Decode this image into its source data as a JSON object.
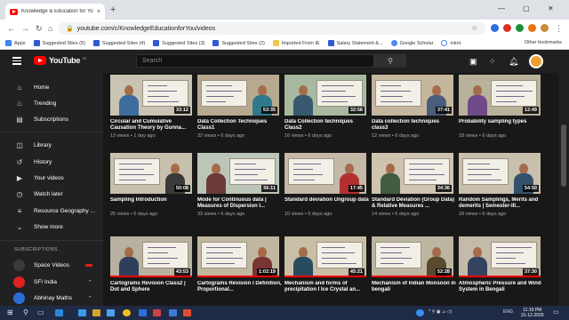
{
  "browser": {
    "tab_title": "Knowledge & Education for You",
    "tab_close": "×",
    "new_tab": "+",
    "url": "youtube.com/c/KnowledgeEducationforYou/videos",
    "window_controls": [
      "—",
      "▢",
      "✕"
    ],
    "bookmarks": [
      {
        "label": "Apps",
        "icon": "apps-grid-icon"
      },
      {
        "label": "Suggested Sites (5)",
        "icon": "bookmark-icon"
      },
      {
        "label": "Suggested Sites (4)",
        "icon": "bookmark-icon"
      },
      {
        "label": "Suggested Sites (3)",
        "icon": "bookmark-icon"
      },
      {
        "label": "Suggested Sites (2)",
        "icon": "bookmark-icon"
      },
      {
        "label": "Imported From IE",
        "icon": "folder-icon"
      },
      {
        "label": "Salary Statement &...",
        "icon": "bookmark-icon"
      },
      {
        "label": "Google Scholar",
        "icon": "scholar-icon"
      },
      {
        "label": "inknt",
        "icon": "google-icon"
      }
    ],
    "other_bookmarks": "Other bookmarks"
  },
  "youtube": {
    "logo_text": "YouTube",
    "logo_region": "IN",
    "search_placeholder": "Search"
  },
  "sidebar": {
    "primary": [
      {
        "label": "Home",
        "icon": "home-icon"
      },
      {
        "label": "Trending",
        "icon": "flame-icon"
      },
      {
        "label": "Subscriptions",
        "icon": "subscriptions-icon"
      }
    ],
    "library": [
      {
        "label": "Library",
        "icon": "library-icon"
      },
      {
        "label": "History",
        "icon": "history-icon"
      },
      {
        "label": "Your videos",
        "icon": "your-videos-icon"
      },
      {
        "label": "Watch later",
        "icon": "clock-icon"
      },
      {
        "label": "Resource Geography ...",
        "icon": "playlist-icon"
      },
      {
        "label": "Show more",
        "icon": "chevron-down-icon"
      }
    ],
    "subscriptions_header": "SUBSCRIPTIONS",
    "subscriptions": [
      {
        "label": "Space Videos",
        "live": true,
        "color": "#3a3a3a"
      },
      {
        "label": "SFI India",
        "live": false,
        "color": "#d22"
      },
      {
        "label": "Abhinay Maths",
        "live": false,
        "color": "#2b6cd6"
      }
    ]
  },
  "videos": [
    {
      "title": "Circular and Cumulative Causation Theory by Gunna...",
      "meta": "13 views • 1 day ago",
      "duration": "33:12"
    },
    {
      "title": "Data Collection Techniques Class1",
      "meta": "32 views • 6 days ago",
      "duration": "53:35"
    },
    {
      "title": "Data Collection techniques Class2",
      "meta": "16 views • 6 days ago",
      "duration": "32:58"
    },
    {
      "title": "Data collection techniques class3",
      "meta": "12 views • 6 days ago",
      "duration": "37:41"
    },
    {
      "title": "Probability sampling types",
      "meta": "18 views • 6 days ago",
      "duration": "12:49"
    },
    {
      "title": "Sampling Introduction",
      "meta": "25 views • 6 days ago",
      "duration": "50:08"
    },
    {
      "title": "Mode for Continuous data | Measures of Dispersion I...",
      "meta": "33 views • 6 days ago",
      "duration": "56:11"
    },
    {
      "title": "Standard deviation Ungroup data",
      "meta": "10 views • 6 days ago",
      "duration": "17:45"
    },
    {
      "title": "Standard Deviation (Group Data) & Relative Measures ...",
      "meta": "14 views • 6 days ago",
      "duration": "34:36"
    },
    {
      "title": "Random Samplings, Merits and demerits | Semester-III...",
      "meta": "18 views • 6 days ago",
      "duration": "54:50"
    },
    {
      "title": "Cartograms Revision Class2 | Dot and Sphere",
      "meta": "",
      "duration": "43:53"
    },
    {
      "title": "Cartograms Revision I Definition, Proportional...",
      "meta": "",
      "duration": "1:02:19"
    },
    {
      "title": "Mechanism and forms of precipitation I Ice Crystal an...",
      "meta": "",
      "duration": "45:21"
    },
    {
      "title": "Mechanism of Indian Monsoon in bengali",
      "meta": "",
      "duration": "52:28"
    },
    {
      "title": "Atmospheric Pressure and Wind System in Bengali",
      "meta": "",
      "duration": "37:30"
    }
  ],
  "taskbar": {
    "language": "ENG",
    "time": "11:19 PM",
    "date": "31-12-2020"
  }
}
